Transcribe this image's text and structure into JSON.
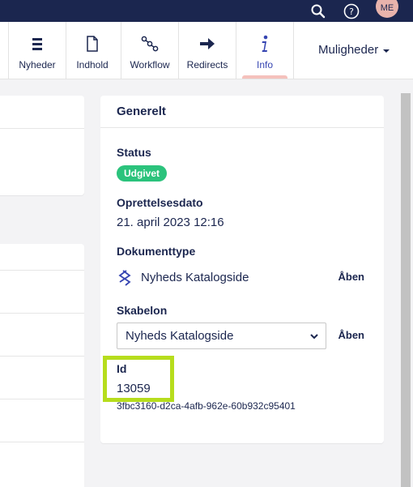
{
  "topbar": {
    "icons": [
      "search-icon",
      "help-icon"
    ],
    "avatar_initials": "ME",
    "colors": {
      "bg": "#1b264f",
      "avatar": "#e8b3ac"
    }
  },
  "apps": [
    {
      "label": "Nyheder",
      "icon": "list-icon"
    },
    {
      "label": "Indhold",
      "icon": "document-icon"
    },
    {
      "label": "Workflow",
      "icon": "workflow-icon"
    },
    {
      "label": "Redirects",
      "icon": "arrow-right-icon"
    },
    {
      "label": "Info",
      "icon": "info-icon",
      "active": true
    }
  ],
  "options_label": "Muligheder",
  "info_panel": {
    "title": "Generelt",
    "status_label": "Status",
    "status_value": "Udgivet",
    "created_label": "Oprettelsesdato",
    "created_value": "21. april 2023 12:16",
    "doctype_label": "Dokumenttype",
    "doctype_value": "Nyheds Katalogside",
    "doctype_link": "Åben",
    "template_label": "Skabelon",
    "template_value": "Nyheds Katalogside",
    "template_link": "Åben",
    "id_label": "Id",
    "id_value": "13059",
    "guid": "3fbc3160-d2ca-4afb-962e-60b932c95401"
  },
  "colors": {
    "accent": "#3544b1",
    "status_green": "#2bc37c",
    "highlight": "#b6dd1d",
    "indicator": "#f5c1bc"
  }
}
